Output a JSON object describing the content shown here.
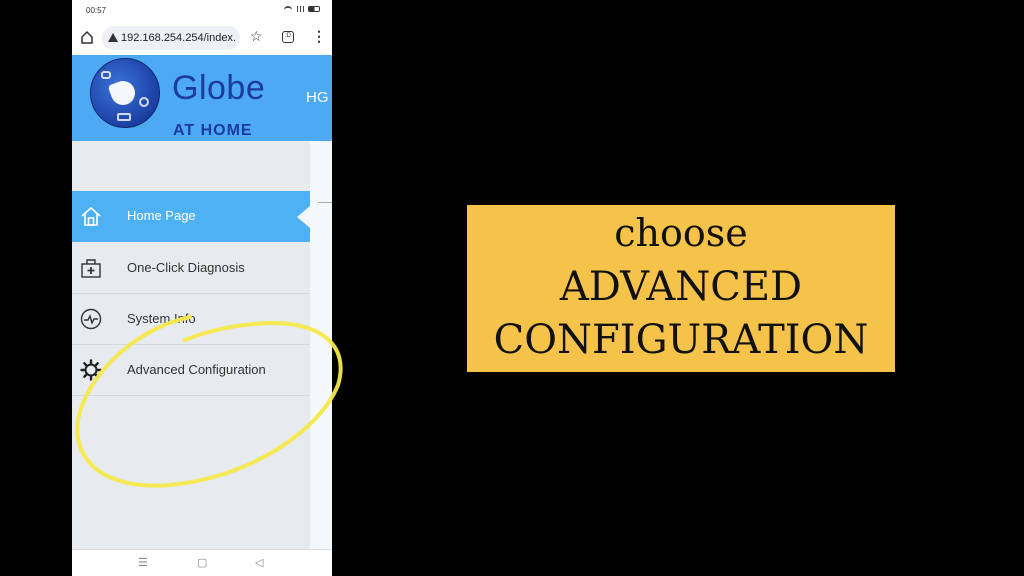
{
  "status_bar": {
    "time": "00:57",
    "icons": [
      "wifi-icon",
      "signal-icon",
      "battery-icon"
    ]
  },
  "browser": {
    "url": "192.168.254.254/index.",
    "security_icon": "warning-triangle-icon",
    "tabs_count_label": ":D"
  },
  "header": {
    "brand_name": "Globe",
    "brand_subtitle": "AT HOME",
    "model_text": "HG",
    "background_color": "#4daaf2",
    "brand_color": "#1c3c9c"
  },
  "sidebar": {
    "active_color": "#4eb1f3",
    "items": [
      {
        "label": "Home Page",
        "icon": "home-icon",
        "active": true
      },
      {
        "label": "One-Click Diagnosis",
        "icon": "medical-kit-icon",
        "active": false
      },
      {
        "label": "System Info",
        "icon": "pulse-icon",
        "active": false
      },
      {
        "label": "Advanced Configuration",
        "icon": "gear-icon",
        "active": false,
        "highlighted": true
      }
    ]
  },
  "android_nav": {
    "buttons": [
      "menu-icon",
      "home-square-icon",
      "back-triangle-icon"
    ]
  },
  "callout": {
    "line1": "choose",
    "line2": "ADVANCED",
    "line3": "CONFIGURATION",
    "background_color": "#f6c34a"
  },
  "annotation": {
    "type": "hand-drawn-circle",
    "color": "#f5e94a",
    "target": "Advanced Configuration"
  }
}
